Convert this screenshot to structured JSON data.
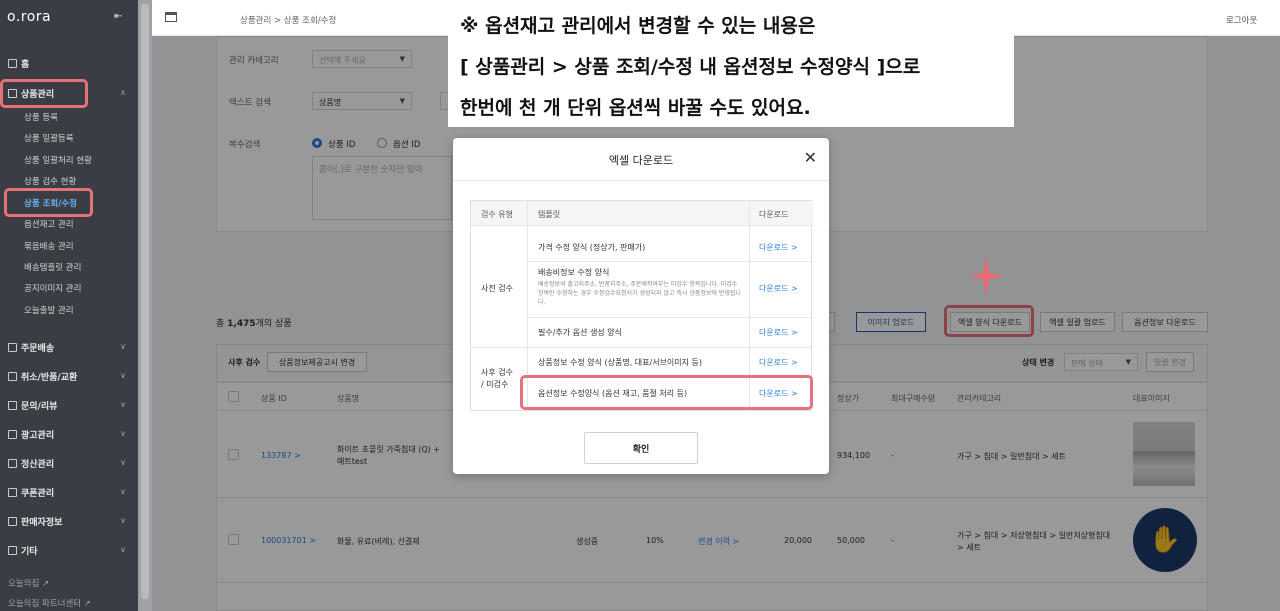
{
  "brand": "o.rora",
  "sidebar": {
    "home": "홈",
    "product_mgmt": "상품관리",
    "sub_items": [
      "상품 등록",
      "상품 일괄등록",
      "상품 일괄처리 현황",
      "상품 검수 현황",
      "상품 조회/수정",
      "옵션재고 관리",
      "묶음배송 관리",
      "배송템플릿 관리",
      "공지이미지 관리",
      "오늘출발 관리"
    ],
    "sections": [
      "주문배송",
      "취소/반품/교환",
      "문의/리뷰",
      "광고관리",
      "정산관리",
      "쿠폰관리",
      "판매자정보",
      "기타"
    ],
    "footer": [
      "오늘의집",
      "오늘의집 파트너센터"
    ]
  },
  "topbar": {
    "breadcrumb": "상품관리  >  상품 조회/수정",
    "logout": "로그아웃"
  },
  "filters": {
    "category_label": "관리 카테고리",
    "category_placeholder": "선택해 주세요",
    "text_search_label": "텍스트 검색",
    "text_search_value": "상품명",
    "multi_search_label": "복수검색",
    "radio_product_id": "상품 ID",
    "radio_option_id": "옵션 ID",
    "textarea_placeholder": "콤마(,)로 구분한 숫자만 입력"
  },
  "list": {
    "total_prefix": "총 ",
    "total_count": "1,475",
    "total_suffix": "개의 상품",
    "buttons": [
      "이미지 업로드",
      "엑셀 양식 다운로드",
      "엑셀 일괄 업로드",
      "옵션정보 다운로드"
    ],
    "post_review": "사후 검수",
    "notice_button": "상품정보제공고시 변경",
    "status_change": "상태 변경",
    "status_select": "판매 상태",
    "bulk_change": "일괄 변경",
    "columns": {
      "product_id": "상품 ID",
      "product_name": "상품명",
      "list_price": "정상가",
      "max_purchase": "최대구매수량",
      "category": "관리카테고리",
      "image": "대표이미지"
    },
    "rows": [
      {
        "id": "133787 >",
        "name": "화이트 초콜릿 가죽침대 (Q) + 매트test",
        "price": "934,100",
        "max": "-",
        "category": "가구 > 침대 > 일반침대 > 세트"
      },
      {
        "id": "100031701 >",
        "name": "화물, 유료(비례), 선결제",
        "status": "생성중",
        "rate": "10%",
        "history": "변경 이력 >",
        "sale": "20,000",
        "price": "50,000",
        "max": "-",
        "category": "가구 > 침대 > 저상형침대 > 일반저상형침대 > 세트"
      }
    ]
  },
  "banner": {
    "line1": "※ 옵션재고 관리에서 변경할 수 있는 내용은",
    "line2": "[ 상품관리 > 상품 조회/수정 내 옵션정보 수정양식 ]으로",
    "line3": "한번에 천 개 단위 옵션씩 바꿀 수도 있어요."
  },
  "modal": {
    "title": "엑셀 다운로드",
    "col_review": "검수 유형",
    "col_template": "템플릿",
    "col_download": "다운로드",
    "pre_review": "사전 검수",
    "post_review_line1": "사후 검수",
    "post_review_line2": "/ 미검수",
    "templates": [
      {
        "name": "가격 수정 양식 (정상가, 판매가)",
        "download": "다운로드 >"
      },
      {
        "name": "배송비정보 수정 양식",
        "desc": "배송정보의 출고지주소, 반품지주소, 주문제작여부는 미검수 항목입니다. 미검수 항목만 수정하는 경우 수정검수요청서가 생성되지 않고 즉시 상품정보에 반영됩니다.",
        "download": "다운로드 >"
      },
      {
        "name": "필수/추가 옵션 생성 양식",
        "download": "다운로드 >"
      },
      {
        "name": "상품정보 수정 양식 (상품명, 대표/서브이미지 등)",
        "download": "다운로드 >"
      },
      {
        "name": "옵션정보 수정양식 (옵션 재고, 품절 처리 등)",
        "download": "다운로드 >"
      }
    ],
    "confirm": "확인"
  },
  "colors": {
    "sidebar_bg": "#3a3d44",
    "accent_blue": "#2b7de0",
    "highlight_red": "#e4727a"
  }
}
